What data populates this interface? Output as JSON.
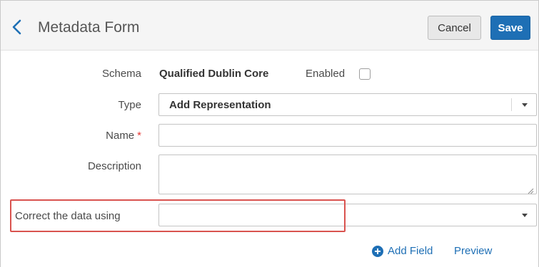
{
  "header": {
    "title": "Metadata Form",
    "cancel_label": "Cancel",
    "save_label": "Save"
  },
  "form": {
    "schema": {
      "label": "Schema",
      "value": "Qualified Dublin Core"
    },
    "enabled": {
      "label": "Enabled",
      "checked": false
    },
    "type": {
      "label": "Type",
      "value": "Add Representation"
    },
    "name": {
      "label": "Name",
      "required_mark": "*",
      "value": "",
      "placeholder": ""
    },
    "description": {
      "label": "Description",
      "value": ""
    },
    "correct_data": {
      "label": "Correct the data using",
      "value": ""
    }
  },
  "actions": {
    "add_field_label": "Add Field",
    "preview_label": "Preview"
  },
  "colors": {
    "accent": "#1e6fb5",
    "highlight": "#d9534f",
    "required": "#e53935"
  }
}
